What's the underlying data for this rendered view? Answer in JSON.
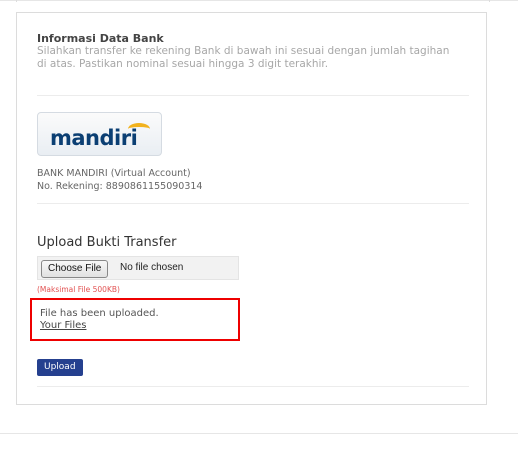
{
  "bank_section": {
    "title": "Informasi Data Bank",
    "description": "Silahkan transfer ke rekening Bank di bawah ini sesuai dengan jumlah tagihan di atas. Pastikan nominal sesuai hingga 3 digit terakhir.",
    "logo_text": "mandiri",
    "bank_name": "BANK MANDIRI (Virtual Account)",
    "account_number": "No. Rekening: 8890861155090314"
  },
  "upload_section": {
    "title": "Upload Bukti Transfer",
    "choose_file_label": "Choose File",
    "no_file_text": "No file chosen",
    "max_size_note": "(Maksimal File 500KB)",
    "uploaded_message": "File has been uploaded.",
    "your_files_link": "Your Files",
    "upload_button": "Upload"
  },
  "colors": {
    "upload_button_bg": "#25408f",
    "notice_border": "#ee0000",
    "max_note": "#e25252"
  }
}
